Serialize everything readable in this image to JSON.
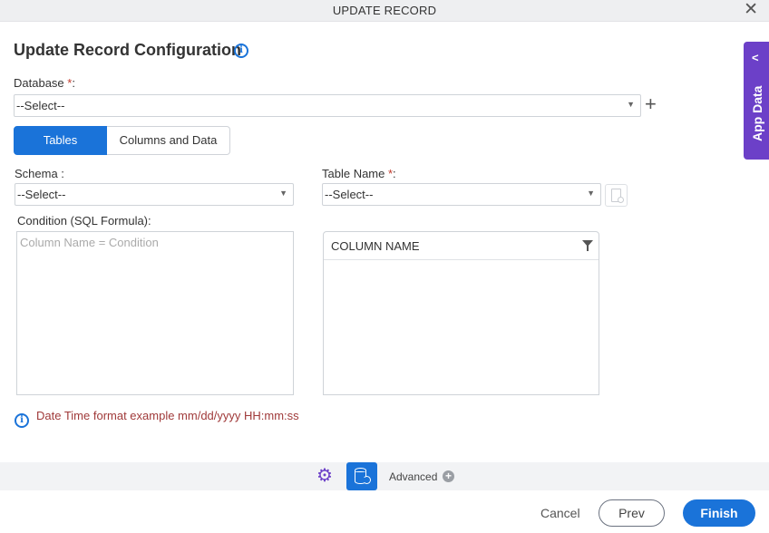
{
  "window": {
    "title": "UPDATE RECORD",
    "close_glyph": "✕"
  },
  "heading": {
    "title": "Update Record Configuration",
    "info_glyph": "i"
  },
  "database": {
    "label": "Database ",
    "required_mark": "*",
    "label_suffix": ":",
    "value": "--Select--",
    "add_glyph": "+"
  },
  "tabs": [
    {
      "label": "Tables",
      "active": true
    },
    {
      "label": "Columns and Data",
      "active": false
    }
  ],
  "schema": {
    "label": "Schema :",
    "value": "--Select--"
  },
  "table_name": {
    "label": "Table Name ",
    "required_mark": "*",
    "label_suffix": ":",
    "value": "--Select--"
  },
  "condition": {
    "label": "Condition (SQL Formula):",
    "placeholder": "Column Name = Condition",
    "value": ""
  },
  "column_grid": {
    "header": "COLUMN NAME",
    "rows": []
  },
  "note": {
    "info_glyph": "i",
    "text": "Date Time format example mm/dd/yyyy HH:mm:ss"
  },
  "app_data": {
    "label": "App Data",
    "chevron": "<"
  },
  "bottom_bar": {
    "advanced_label": "Advanced",
    "advanced_plus": "+",
    "gear_glyph": "⚙"
  },
  "footer": {
    "cancel_label": "Cancel",
    "prev_label": "Prev",
    "finish_label": "Finish"
  },
  "colors": {
    "primary": "#1a73d9",
    "app_data": "#6c40c8",
    "note_text": "#a03a3a",
    "required": "#c0392b"
  },
  "dropdown_arrow": "▼"
}
